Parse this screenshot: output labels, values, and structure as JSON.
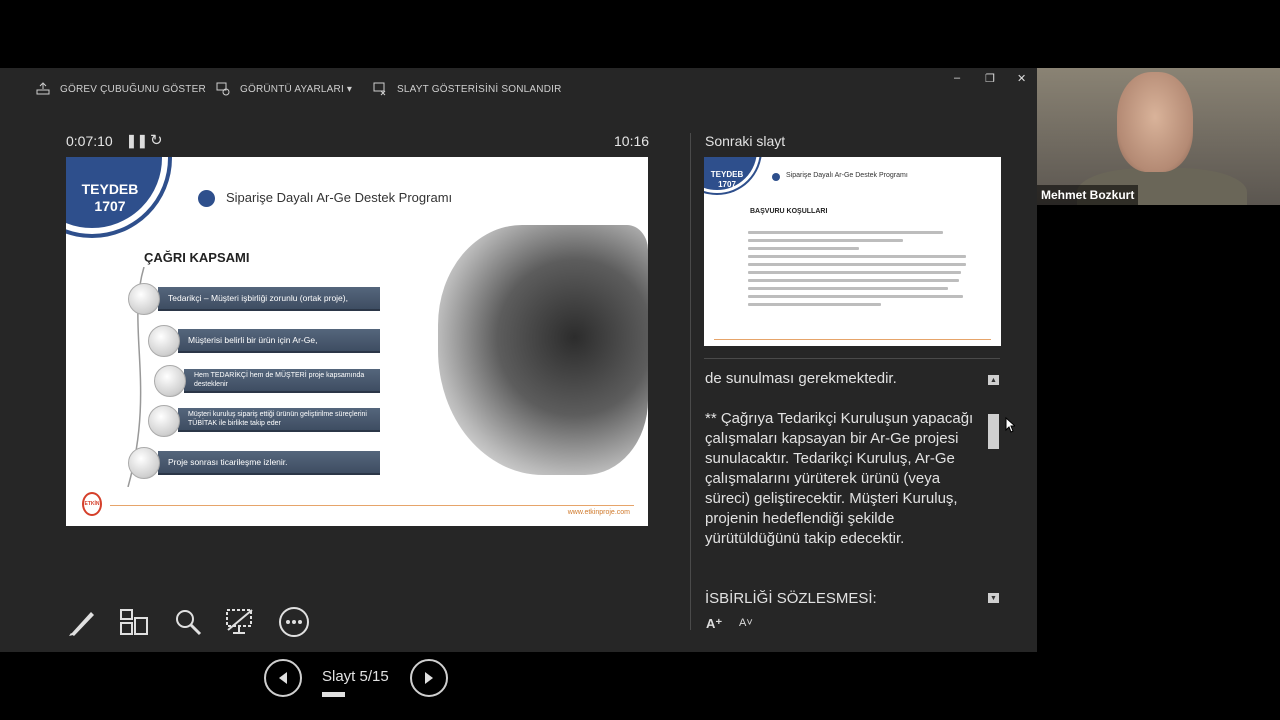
{
  "toolbar": {
    "show_taskbar": "GÖREV ÇUBUĞUNU GÖSTER",
    "display_settings": "GÖRÜNTÜ AYARLARI ▾",
    "end_show": "SLAYT GÖSTERİSİNİ SONLANDIR"
  },
  "window": {
    "minimize": "–",
    "restore": "❐",
    "close": "✕"
  },
  "timer": {
    "elapsed": "0:07:10",
    "clock": "10:16"
  },
  "slide": {
    "badge": "TEYDEB\n1707",
    "title": "Siparişe Dayalı Ar-Ge Destek Programı",
    "heading": "ÇAĞRI KAPSAMI",
    "items": [
      "Tedarikçi – Müşteri işbirliği zorunlu (ortak proje),",
      "Müşterisi belirli bir ürün için Ar-Ge,",
      "Hem TEDARİKÇİ hem de MÜŞTERİ proje kapsamında desteklenir",
      "Müşteri kuruluş sipariş ettiği ürünün geliştirilme süreçlerini TÜBİTAK ile birlikte takip eder",
      "Proje sonrası ticarileşme izlenir."
    ],
    "url": "www.etkinproje.com",
    "logo": "ETKİN PROJE"
  },
  "navigation": {
    "slide_counter": "Slayt 5/15",
    "progress": 0.33
  },
  "next_slide": {
    "label": "Sonraki slayt",
    "badge": "TEYDEB\n1707",
    "title": "Siparişe Dayalı Ar-Ge Destek Programı",
    "heading": "BAŞVURU KOŞULLARI"
  },
  "notes": {
    "line1": "de sunulması gerekmektedir.",
    "para": "** Çağrıya Tedarikçi Kuruluşun yapacağı çalışmaları kapsayan bir Ar-Ge projesi sunulacaktır. Tedarikçi Kuruluş, Ar-Ge çalışmalarını yürüterek ürünü (veya süreci) geliştirecektir. Müşteri Kuruluş, projenin hedeflendiği şekilde yürütüldüğünü takip edecektir.",
    "section": "İSBİRLİĞİ SÖZLESMESİ:",
    "font_increase": "A⁺",
    "font_decrease": "A˅"
  },
  "webcam": {
    "name": "Mehmet Bozkurt"
  }
}
